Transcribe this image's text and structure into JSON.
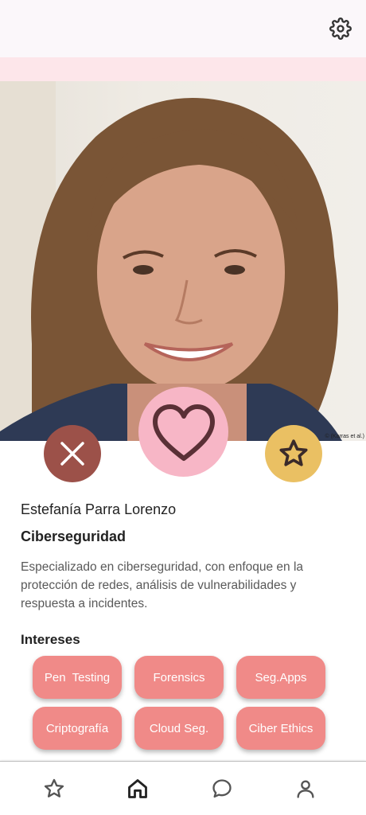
{
  "header": {
    "settings_icon": "gear-icon"
  },
  "photo": {
    "credit": "© (Karras et al.)",
    "alt": "profile-photo"
  },
  "actions": {
    "dislike_icon": "close-icon",
    "like_icon": "heart-icon",
    "superlike_icon": "star-icon"
  },
  "profile": {
    "name": "Estefanía Parra Lorenzo",
    "field": "Ciberseguridad",
    "description": "Especializado en ciberseguridad, con enfoque en la protección de redes, análisis de vulnerabilidades y respuesta a incidentes.",
    "interests_title": "Intereses",
    "interests": [
      "Pen  Testing",
      "Forensics",
      "Seg.Apps",
      "Criptografía",
      "Cloud Seg.",
      "Ciber Ethics"
    ]
  },
  "nav": {
    "items": [
      "star-icon",
      "home-icon",
      "chat-icon",
      "user-icon"
    ],
    "active": "home-icon"
  },
  "colors": {
    "dislike": "#9c5149",
    "like": "#f7b6c6",
    "superlike": "#eac063",
    "chip": "#f08a88",
    "top_band": "#fde6ea"
  }
}
